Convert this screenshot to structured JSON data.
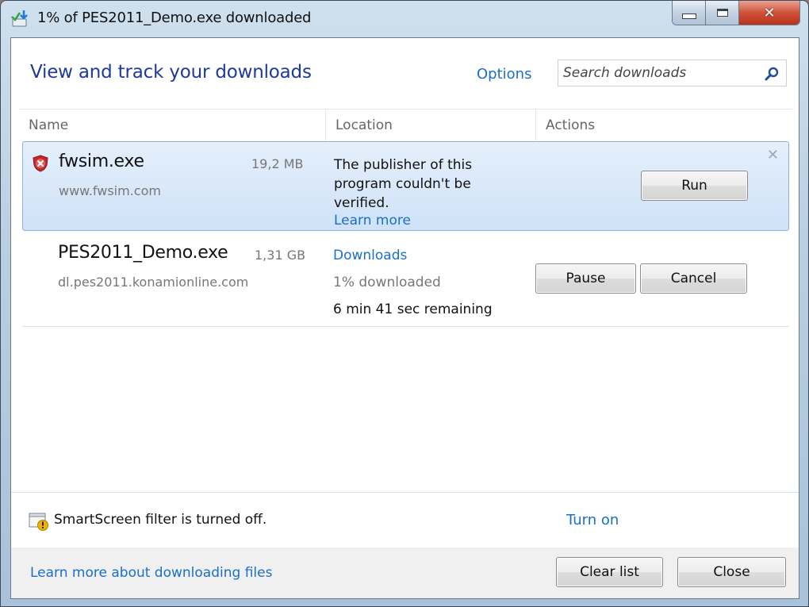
{
  "window": {
    "title": "1% of PES2011_Demo.exe downloaded",
    "minimize_glyph": "",
    "close_glyph": "✕"
  },
  "header": {
    "title": "View and track your downloads",
    "options_label": "Options",
    "search_placeholder": "Search downloads"
  },
  "columns": [
    {
      "label": "Name"
    },
    {
      "label": "Location"
    },
    {
      "label": "Actions"
    }
  ],
  "downloads": [
    {
      "name": "fwsim.exe",
      "size": "19,2 MB",
      "source": "www.fwsim.com",
      "status_lines": [
        "The publisher of this",
        "program couldn't be",
        "verified."
      ],
      "learn_more": "Learn more",
      "actions": [
        "Run"
      ],
      "dismiss": "✕",
      "selected": true,
      "icon": "shield-blocked-icon"
    },
    {
      "name": "PES2011_Demo.exe",
      "size": "1,31 GB",
      "source": "dl.pes2011.konamionline.com",
      "location": "Downloads",
      "progress_text": "1% downloaded",
      "progress_percent": 1,
      "remaining": "6 min 41 sec remaining",
      "actions": [
        "Pause",
        "Cancel"
      ],
      "selected": false
    }
  ],
  "smartscreen": {
    "message": "SmartScreen filter is turned off.",
    "action": "Turn on",
    "icon": "smartscreen-warning-icon"
  },
  "footer": {
    "learn_link": "Learn more about downloading files",
    "clear_label": "Clear list",
    "close_label": "Close"
  },
  "colors": {
    "link": "#1a6fc9",
    "heading": "#1e3a9b",
    "selected_row": "#cfe2f8"
  }
}
